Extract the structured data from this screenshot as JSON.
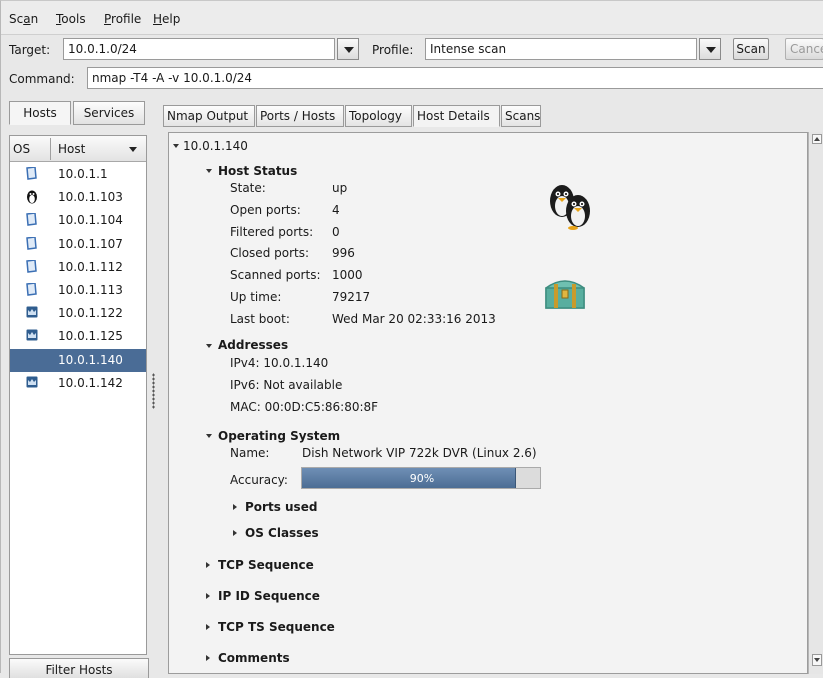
{
  "menu": {
    "scan_prefix": "Sc",
    "scan_u": "a",
    "scan_suffix": "n",
    "tools_u": "T",
    "tools_rest": "ools",
    "profile_u": "P",
    "profile_rest": "rofile",
    "help_u": "H",
    "help_rest": "elp"
  },
  "toolbar": {
    "target_label": "Target:",
    "target_value": "10.0.1.0/24",
    "profile_label": "Profile:",
    "profile_value": "Intense scan",
    "scan_button": "Scan",
    "cancel_button": "Cancel",
    "command_label": "Command:",
    "command_value": "nmap -T4 -A -v 10.0.1.0/24"
  },
  "left_tabs": {
    "hosts": "Hosts",
    "services": "Services"
  },
  "host_list": {
    "col_os": "OS",
    "col_host": "Host",
    "hosts": [
      {
        "ip": "10.0.1.1",
        "os_icon": "generic-os-icon"
      },
      {
        "ip": "10.0.1.103",
        "os_icon": "linux-penguin-icon"
      },
      {
        "ip": "10.0.1.104",
        "os_icon": "generic-os-icon"
      },
      {
        "ip": "10.0.1.107",
        "os_icon": "generic-os-icon"
      },
      {
        "ip": "10.0.1.112",
        "os_icon": "generic-os-icon"
      },
      {
        "ip": "10.0.1.113",
        "os_icon": "generic-os-icon"
      },
      {
        "ip": "10.0.1.122",
        "os_icon": "macos-icon"
      },
      {
        "ip": "10.0.1.125",
        "os_icon": "macos-icon"
      },
      {
        "ip": "10.0.1.140",
        "os_icon": "linux-penguin-icon",
        "selected": true
      },
      {
        "ip": "10.0.1.142",
        "os_icon": "macos-icon"
      }
    ],
    "filter_button": "Filter Hosts"
  },
  "right_tabs": [
    "Nmap Output",
    "Ports / Hosts",
    "Topology",
    "Host Details",
    "Scans"
  ],
  "active_tab": "Host Details",
  "details": {
    "host": "10.0.1.140",
    "host_status": {
      "title": "Host Status",
      "rows": [
        {
          "k": "State:",
          "v": "up"
        },
        {
          "k": "Open ports:",
          "v": "4"
        },
        {
          "k": "Filtered ports:",
          "v": "0"
        },
        {
          "k": "Closed ports:",
          "v": "996"
        },
        {
          "k": "Scanned ports:",
          "v": "1000"
        },
        {
          "k": "Up time:",
          "v": "79217"
        },
        {
          "k": "Last boot:",
          "v": "Wed Mar 20 02:33:16 2013"
        }
      ]
    },
    "addresses": {
      "title": "Addresses",
      "ipv4": "IPv4:  10.0.1.140",
      "ipv6": "IPv6:  Not available",
      "mac": "MAC:  00:0D:C5:86:80:8F"
    },
    "os": {
      "title": "Operating System",
      "name_label": "Name:",
      "name_value": "Dish Network VIP 722k DVR (Linux 2.6)",
      "accuracy_label": "Accuracy:",
      "accuracy_text": "90%",
      "accuracy_fraction": 0.9,
      "ports_used": "Ports used",
      "os_classes": "OS Classes"
    },
    "sections": [
      "TCP Sequence",
      "IP ID Sequence",
      "TCP TS Sequence",
      "Comments"
    ]
  },
  "colors": {
    "selection": "#4a6c96",
    "progress": "#4c6d94"
  }
}
